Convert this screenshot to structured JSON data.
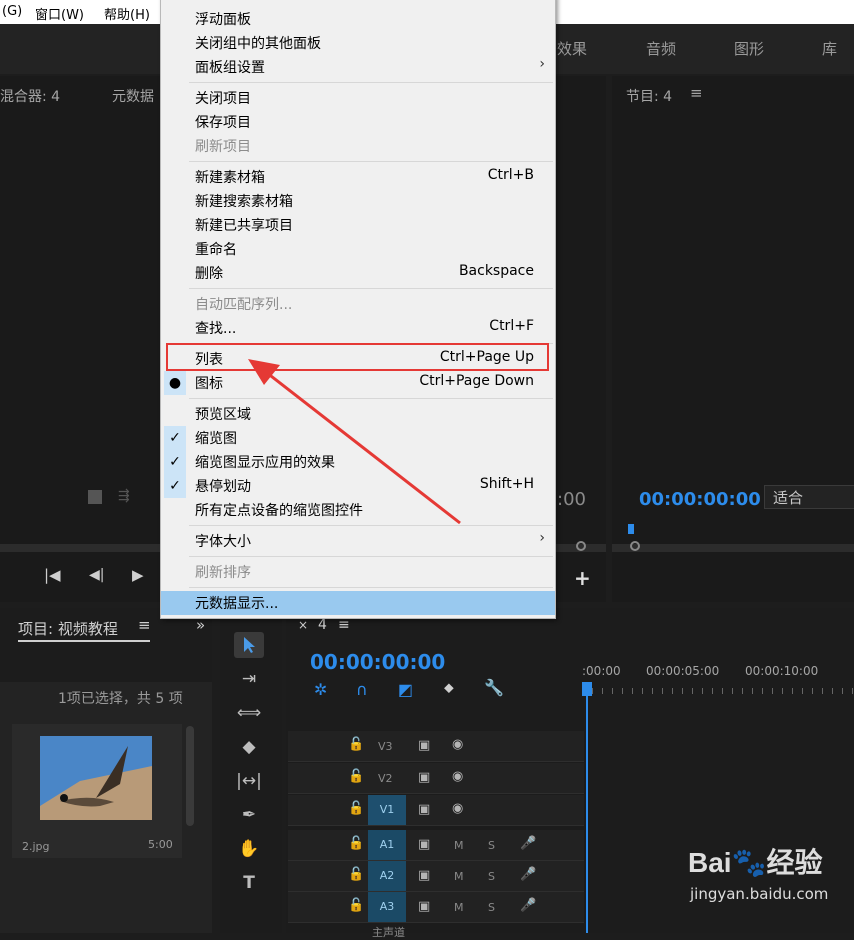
{
  "menubar": {
    "items": [
      "(G)",
      "窗口(W)",
      "帮助(H)"
    ]
  },
  "workspace_tabs": [
    "效果",
    "音频",
    "图形",
    "库"
  ],
  "source_panel": {
    "tabs": [
      "混合器: 4",
      "元数据"
    ]
  },
  "program_panel": {
    "title": "节目: 4",
    "timecode": "00:00:00:00",
    "fit": "适合",
    "partial_time": ":00"
  },
  "project_panel": {
    "title": "项目: 视频教程",
    "status": "1项已选择，共 5 项",
    "clip_name": "2.jpg",
    "clip_duration": "5:00"
  },
  "timeline": {
    "tab": "4",
    "timecode": "00:00:00:00",
    "ruler": [
      ":00:00",
      "00:00:05:00",
      "00:00:10:00"
    ],
    "tracks": [
      "V3",
      "V2",
      "V1",
      "A1",
      "A2",
      "A3"
    ],
    "m_label": "M",
    "s_label": "S",
    "extra": "主声道"
  },
  "context_menu": {
    "items": [
      {
        "label": "浮动面板",
        "shortcut": ""
      },
      {
        "label": "关闭组中的其他面板",
        "shortcut": ""
      },
      {
        "label": "面板组设置",
        "shortcut": "",
        "submenu": true
      },
      {
        "label": "关闭项目",
        "shortcut": ""
      },
      {
        "label": "保存项目",
        "shortcut": ""
      },
      {
        "label": "刷新项目",
        "shortcut": "",
        "disabled": true
      },
      {
        "label": "新建素材箱",
        "shortcut": "Ctrl+B"
      },
      {
        "label": "新建搜索素材箱",
        "shortcut": ""
      },
      {
        "label": "新建已共享项目",
        "shortcut": ""
      },
      {
        "label": "重命名",
        "shortcut": ""
      },
      {
        "label": "删除",
        "shortcut": "Backspace"
      },
      {
        "label": "自动匹配序列...",
        "shortcut": "",
        "disabled": true
      },
      {
        "label": "查找...",
        "shortcut": "Ctrl+F"
      },
      {
        "label": "列表",
        "shortcut": "Ctrl+Page Up"
      },
      {
        "label": "图标",
        "shortcut": "Ctrl+Page Down",
        "bullet": true
      },
      {
        "label": "预览区域",
        "shortcut": ""
      },
      {
        "label": "缩览图",
        "shortcut": "",
        "checked": true
      },
      {
        "label": "缩览图显示应用的效果",
        "shortcut": "",
        "checked": true
      },
      {
        "label": "悬停划动",
        "shortcut": "Shift+H",
        "checked": true
      },
      {
        "label": "所有定点设备的缩览图控件",
        "shortcut": ""
      },
      {
        "label": "字体大小",
        "shortcut": "",
        "submenu": true
      },
      {
        "label": "刷新排序",
        "shortcut": "",
        "disabled": true
      },
      {
        "label": "元数据显示...",
        "shortcut": "",
        "highlighted": true
      }
    ]
  },
  "watermark": {
    "brand": "Bai",
    "brand2": "经验",
    "url": "jingyan.baidu.com"
  },
  "colors": {
    "accent": "#2d8ceb",
    "annotation": "#e53935",
    "menu_highlight": "#99c9ef"
  }
}
